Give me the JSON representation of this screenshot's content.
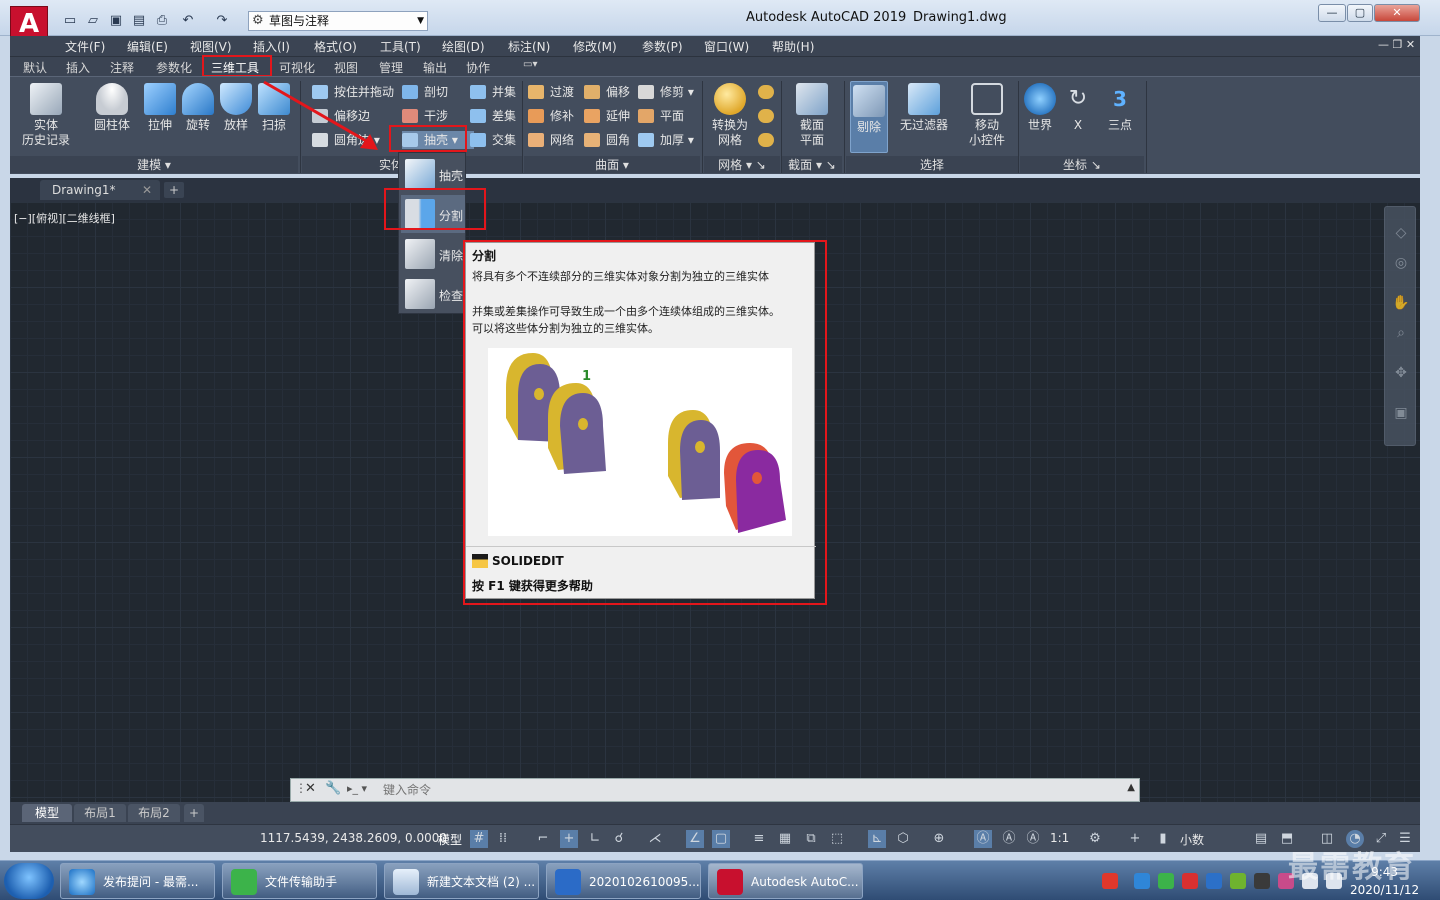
{
  "window": {
    "app_title": "Autodesk AutoCAD 2019",
    "file_name": "Drawing1.dwg",
    "workspace": "草图与注释"
  },
  "menubar": [
    "文件(F)",
    "编辑(E)",
    "视图(V)",
    "插入(I)",
    "格式(O)",
    "工具(T)",
    "绘图(D)",
    "标注(N)",
    "修改(M)",
    "参数(P)",
    "窗口(W)",
    "帮助(H)"
  ],
  "ribbon_tabs": [
    "默认",
    "插入",
    "注释",
    "参数化",
    "三维工具",
    "可视化",
    "视图",
    "管理",
    "输出",
    "协作"
  ],
  "ribbon": {
    "modeling": {
      "title": "建模",
      "buttons": [
        "实体\n历史记录",
        "圆柱体",
        "拉伸",
        "旋转",
        "放样",
        "扫掠"
      ]
    },
    "solid_editing": {
      "title": "实体",
      "col1": [
        "按住并拖动",
        "偏移边",
        "圆角边"
      ],
      "col2": [
        "剖切",
        "干涉",
        "抽壳"
      ],
      "col3": [
        "并集",
        "差集",
        "交集"
      ]
    },
    "surface": {
      "title": "曲面",
      "col1": [
        "过渡",
        "修补",
        "网络"
      ],
      "col2": [
        "偏移",
        "延伸",
        "圆角"
      ],
      "col3": [
        "修剪",
        "平面",
        "加厚"
      ]
    },
    "mesh": {
      "title": "网格",
      "buttons": [
        "转换为\n网格"
      ]
    },
    "section": {
      "title": "截面",
      "buttons": [
        "截面\n平面"
      ]
    },
    "selection": {
      "title": "选择",
      "buttons": [
        "剔除",
        "无过滤器",
        "移动\n小控件"
      ]
    },
    "coordinates": {
      "title": "坐标",
      "buttons": [
        "世界",
        "X",
        "三点"
      ]
    }
  },
  "document_tab": "Drawing1*",
  "view_label": "[−][俯视][二维线框]",
  "dropdown": {
    "items": [
      "抽壳",
      "分割",
      "清除",
      "检查"
    ],
    "selected": "分割"
  },
  "tooltip": {
    "title": "分割",
    "line1": "将具有多个不连续部分的三维实体对象分割为独立的三维实体",
    "line2": "并集或差集操作可导致生成一个由多个连续体组成的三维实体。",
    "line3": "可以将这些体分割为独立的三维实体。",
    "marker": "1",
    "command": "SOLIDEDIT",
    "help": "按 F1 键获得更多帮助"
  },
  "command_line": {
    "placeholder": "键入命令"
  },
  "layout_tabs": [
    "模型",
    "布局1",
    "布局2"
  ],
  "statusbar": {
    "coords": "1117.5439, 2438.2609, 0.0000",
    "model": "模型",
    "scale": "1:1",
    "units": "小数"
  },
  "taskbar": {
    "tasks": [
      "发布提问 - 最需...",
      "文件传输助手",
      "新建文本文档 (2) ...",
      "2020102610095...",
      "Autodesk AutoC..."
    ],
    "time": "9:43",
    "date": "2020/11/12"
  },
  "watermark": "最需教育",
  "colors": {
    "highlight": "#e3161b",
    "ribbon_bg": "#434d5d",
    "canvas_bg": "#212830"
  }
}
